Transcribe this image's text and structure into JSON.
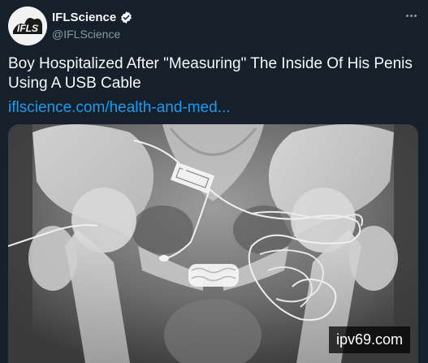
{
  "author": {
    "display_name": "IFLScience",
    "handle": "@IFLScience",
    "avatar_text": "IFLS",
    "verified": true
  },
  "tweet": {
    "text": "Boy Hospitalized After \"Measuring\" The Inside Of His Penis Using A USB Cable",
    "link_text": "iflscience.com/health-and-med..."
  },
  "media": {
    "watermark": "ipv69.com"
  },
  "icons": {
    "verified": "verified-badge-icon",
    "more": "more-options-icon"
  },
  "colors": {
    "background": "#15202b",
    "link": "#1d9bf0",
    "secondary_text": "#8b98a5"
  }
}
